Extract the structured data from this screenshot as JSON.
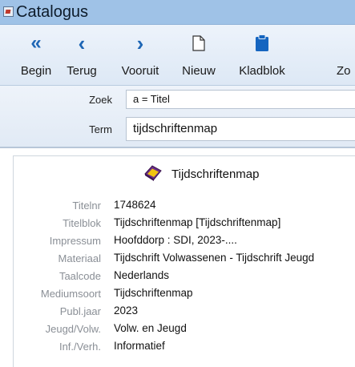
{
  "window": {
    "title": "Catalogus"
  },
  "toolbar": {
    "buttons": [
      {
        "icon": "double-left-arrow-icon",
        "glyph": "«",
        "label": "Begin"
      },
      {
        "icon": "left-arrow-icon",
        "glyph": "‹",
        "label": "Terug"
      },
      {
        "icon": "right-arrow-icon",
        "glyph": "›",
        "label": "Vooruit"
      },
      {
        "icon": "new-document-icon",
        "glyph": "",
        "label": "Nieuw"
      },
      {
        "icon": "clipboard-icon",
        "glyph": "",
        "label": "Kladblok"
      },
      {
        "icon": "search-icon",
        "glyph": "",
        "label": "Zo"
      }
    ]
  },
  "search": {
    "zoek_label": "Zoek",
    "zoek_value": "a = Titel",
    "term_label": "Term",
    "term_value": "tijdschriftenmap"
  },
  "record": {
    "title": "Tijdschriftenmap",
    "fields": [
      {
        "label": "Titelnr",
        "value": "1748624"
      },
      {
        "label": "Titelblok",
        "value": "Tijdschriftenmap [Tijdschriftenmap]"
      },
      {
        "label": "Impressum",
        "value": "Hoofddorp : SDI, 2023-...."
      },
      {
        "label": "Materiaal",
        "value": "Tijdschrift Volwassenen - Tijdschrift Jeugd"
      },
      {
        "label": "Taalcode",
        "value": "Nederlands"
      },
      {
        "label": "Mediumsoort",
        "value": "Tijdschriftenmap"
      },
      {
        "label": "Publ.jaar",
        "value": "2023"
      },
      {
        "label": "Jeugd/Volw.",
        "value": "Volw. en Jeugd"
      },
      {
        "label": "Inf./Verh.",
        "value": "Informatief"
      }
    ]
  },
  "colors": {
    "titlebar": "#9fc2e7",
    "toolbar_icon": "#1e66b5",
    "field_label": "#8a8f96"
  }
}
